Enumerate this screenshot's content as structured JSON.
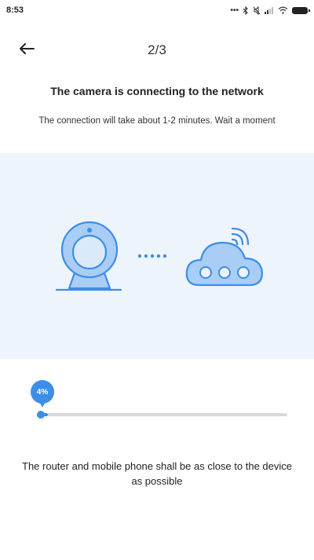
{
  "status_bar": {
    "time": "8:53",
    "icons": [
      "dots-icon",
      "bluetooth-icon",
      "mute-icon",
      "signal-icon",
      "wifi-icon",
      "battery-icon"
    ]
  },
  "nav": {
    "step": "2/3",
    "back_icon": "arrow-left-icon"
  },
  "content": {
    "headline": "The camera is connecting to the network",
    "subtext": "The connection will take about 1-2 minutes. Wait a moment",
    "tip": "The router and mobile phone shall be as close to the device as possible"
  },
  "progress": {
    "label": "4%",
    "value": 0.04
  },
  "colors": {
    "accent": "#3c8ee8",
    "panel_bg": "#eef4fb",
    "track": "#d9d9d9"
  }
}
